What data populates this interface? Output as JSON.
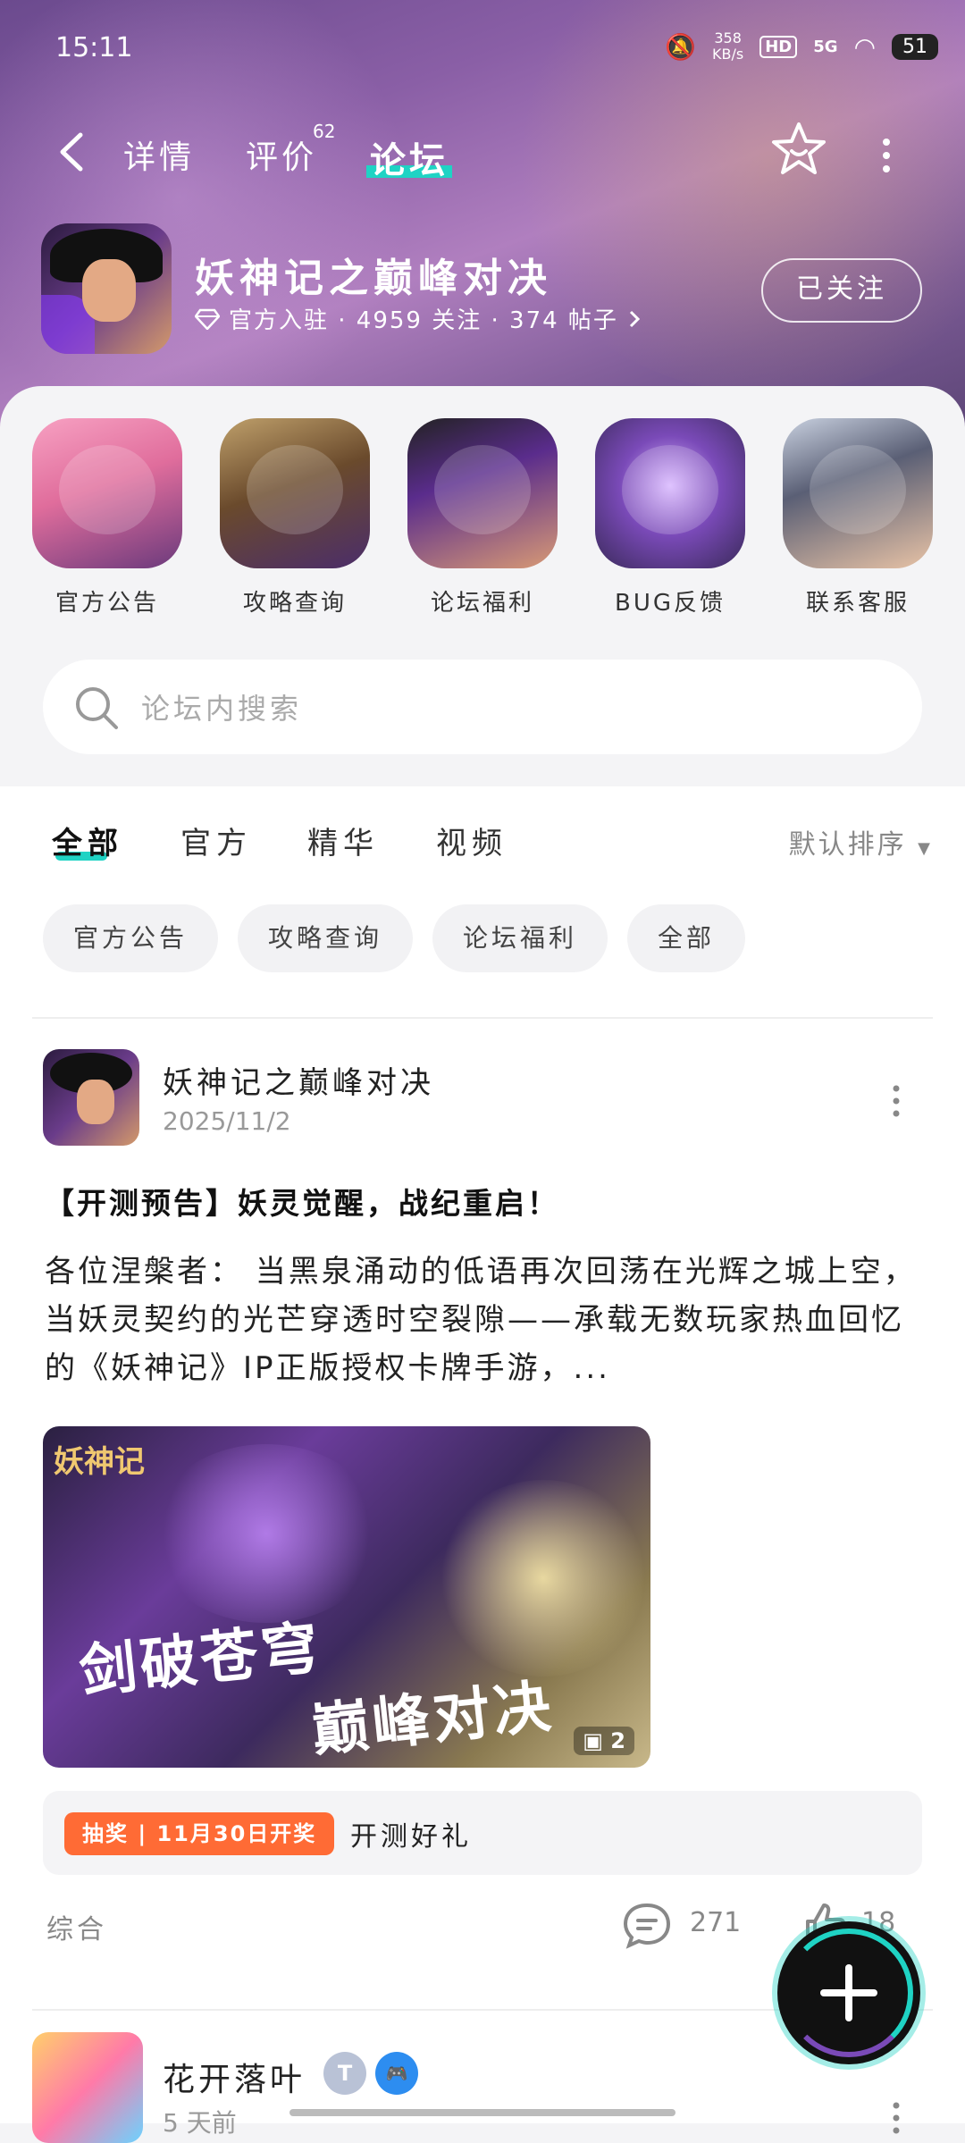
{
  "status": {
    "time": "15:11",
    "netspeed_value": "358",
    "netspeed_unit": "KB/s",
    "hd": "HD",
    "signal": "5G",
    "battery": "51"
  },
  "nav": {
    "tabs": [
      "详情",
      "评价",
      "论坛"
    ],
    "review_count": "62"
  },
  "game": {
    "title": "妖神记之巅峰对决",
    "meta": "官方入驻 · 4959 关注 · 374 帖子",
    "follow_label": "已关注"
  },
  "categories": [
    {
      "label": "官方公告"
    },
    {
      "label": "攻略查询"
    },
    {
      "label": "论坛福利"
    },
    {
      "label": "BUG反馈"
    },
    {
      "label": "联系客服"
    }
  ],
  "search": {
    "placeholder": "论坛内搜索"
  },
  "feed_tabs": [
    "全部",
    "官方",
    "精华",
    "视频"
  ],
  "sort_label": "默认排序",
  "chips": [
    "官方公告",
    "攻略查询",
    "论坛福利",
    "全部"
  ],
  "post": {
    "author": "妖神记之巅峰对决",
    "date": "2025/11/2",
    "title": "【开测预告】妖灵觉醒，战纪重启！",
    "body": "各位涅槃者： 当黑泉涌动的低语再次回荡在光辉之城上空，当妖灵契约的光芒穿透时空裂隙——承载无数玩家热血回忆的《妖神记》IP正版授权卡牌手游，...",
    "image_logo": "妖神记",
    "image_slogan1": "剑破苍穹",
    "image_slogan2": "巅峰对决",
    "image_count": "2",
    "prize_tag": "抽奖 | 11月30日开奖",
    "prize_text": "开测好礼",
    "category": "综合",
    "comments": "271",
    "likes": "18"
  },
  "post2": {
    "author": "花开落叶",
    "date": "5 天前"
  },
  "colors": {
    "accent": "#1fd3c4",
    "prize": "#ff6b35"
  }
}
